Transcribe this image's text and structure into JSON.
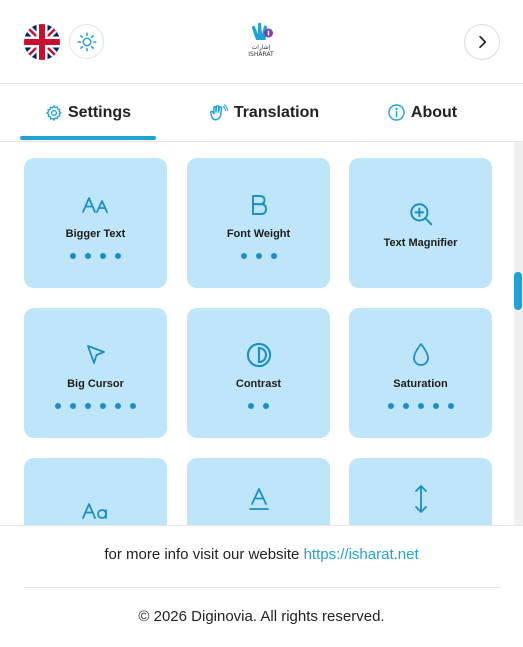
{
  "header": {
    "language_flag": "uk-flag-icon",
    "theme_icon": "sun-icon",
    "logo": {
      "text_arabic": "إشارات",
      "text_latin": "ISHARAT"
    },
    "next_icon": "chevron-right-icon"
  },
  "tabs": [
    {
      "label": "Settings",
      "icon": "gear-icon",
      "active": true
    },
    {
      "label": "Translation",
      "icon": "hand-icon",
      "active": false
    },
    {
      "label": "About",
      "icon": "info-icon",
      "active": false
    }
  ],
  "cards": [
    {
      "label": "Bigger Text",
      "icon": "text-size-icon",
      "dots": 4
    },
    {
      "label": "Font Weight",
      "icon": "bold-icon",
      "dots": 3
    },
    {
      "label": "Text Magnifier",
      "icon": "zoom-in-icon",
      "dots": 0
    },
    {
      "label": "Big Cursor",
      "icon": "cursor-icon",
      "dots": 6
    },
    {
      "label": "Contrast",
      "icon": "contrast-icon",
      "dots": 2
    },
    {
      "label": "Saturation",
      "icon": "droplet-icon",
      "dots": 5
    },
    {
      "label": "",
      "icon": "font-icon",
      "dots": 0
    },
    {
      "label": "",
      "icon": "text-underline-icon",
      "dots": 0
    },
    {
      "label": "",
      "icon": "line-height-icon",
      "dots": 0
    }
  ],
  "footer": {
    "info_text": "for more info visit our website",
    "link_text": "https://isharat.net",
    "copyright": "© 2026 Diginovia. All rights reserved."
  },
  "colors": {
    "accent": "#1fa3d6",
    "card_bg": "#bfe6f8",
    "dot": "#1b8ec4"
  }
}
